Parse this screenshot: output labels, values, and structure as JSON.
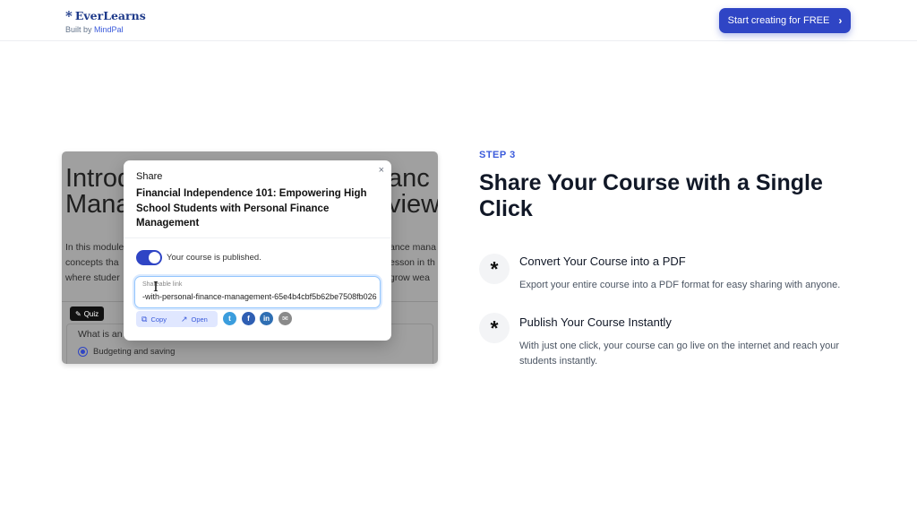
{
  "header": {
    "brand_name": "EverLearns",
    "brand_sub_prefix": "Built by ",
    "brand_sub_accent": "MindPal",
    "cta_label": "Start creating for FREE"
  },
  "background": {
    "title_left": "Introd\nMana",
    "title_right": "anc\nview",
    "para_left": "In this module\nconcepts tha\nwhere studer",
    "para_right": "ance mana\nesson in th\ngrow wea",
    "quiz_badge": "Quiz",
    "quiz_question": "What is an",
    "quiz_option": "Budgeting and saving"
  },
  "modal": {
    "label": "Share",
    "close": "×",
    "title": "Financial Independence 101: Empowering High School Students with Personal Finance Management",
    "published_text": "Your course is published.",
    "link_label": "Shareable link",
    "link_value": "-with-personal-finance-management-65e4b4cbf5b62be7508fb026",
    "copy_label": "Copy",
    "open_label": "Open"
  },
  "content": {
    "step": "STEP 3",
    "heading": "Share Your Course with a Single Click",
    "features": [
      {
        "title": "Convert Your Course into a PDF",
        "desc": "Export your entire course into a PDF format for easy sharing with anyone."
      },
      {
        "title": "Publish Your Course Instantly",
        "desc": "With just one click, your course can go live on the internet and reach your students instantly."
      }
    ]
  },
  "colors": {
    "accent": "#2f45c5",
    "brand": "#1e3a8a"
  }
}
